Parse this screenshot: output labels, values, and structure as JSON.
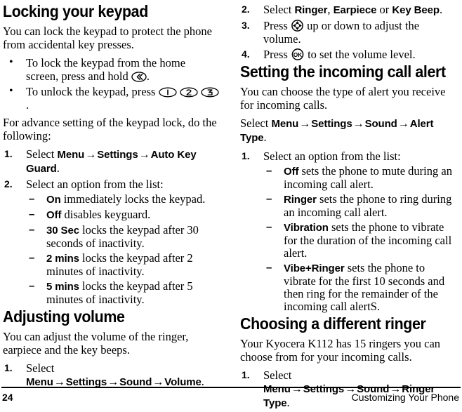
{
  "document": {
    "page_number": "24",
    "chapter_title": "Customizing Your Phone"
  },
  "left_column": {
    "heading_1": "Locking your keypad",
    "intro": "You can lock the keypad to protect the phone from accidental key presses.",
    "bullets": [
      {
        "text_before": "To lock the keypad from the home screen, press and hold",
        "icon": "back-key-icon",
        "text_after": "."
      },
      {
        "text_before": "To unlock the keypad, press",
        "icons": [
          "key-1-icon",
          "key-2-icon",
          "key-3-icon"
        ],
        "text_after": "."
      }
    ],
    "advance_intro": "For advance setting of the keypad lock, do the following:",
    "steps": [
      {
        "num": "1.",
        "lead": "Select",
        "path": [
          "Menu",
          "Settings",
          "Auto Key Guard"
        ],
        "tail": "."
      },
      {
        "num": "2.",
        "lead": "Select an option from the list:",
        "options": [
          {
            "term": "On",
            "desc": "immediately locks the keypad."
          },
          {
            "term": "Off",
            "desc": "disables keyguard."
          },
          {
            "term": "30 Sec",
            "desc": "locks the keypad after 30 seconds of inactivity."
          },
          {
            "term": "2 mins",
            "desc": "locks the keypad after 2 minutes of inactivity."
          },
          {
            "term": "5 mins",
            "desc": "locks the keypad after 5 minutes of inactivity."
          }
        ]
      }
    ],
    "heading_2": "Adjusting volume",
    "volume_intro": "You can adjust the volume of the ringer, earpiece and the key beeps.",
    "volume_step": {
      "num": "1.",
      "lead": "Select",
      "path": [
        "Menu",
        "Settings",
        "Sound",
        "Volume"
      ],
      "tail": "."
    }
  },
  "right_column": {
    "volume_steps": [
      {
        "num": "2.",
        "lead": "Select",
        "terms": [
          "Ringer",
          "Earpiece",
          "Key Beep"
        ],
        "separator_1": ",",
        "separator_2": "or",
        "tail": "."
      },
      {
        "num": "3.",
        "lead": "Press",
        "icon": "nav-key-icon",
        "tail": "up or down to adjust the volume."
      },
      {
        "num": "4.",
        "lead": "Press",
        "icon": "ok-key-icon",
        "tail": "to set the volume level."
      }
    ],
    "heading_1": "Setting the incoming call alert",
    "alert_intro": "You can choose the type of alert you receive for incoming calls.",
    "alert_select": {
      "lead": "Select",
      "path": [
        "Menu",
        "Settings",
        "Sound",
        "Alert Type"
      ],
      "tail": "."
    },
    "alert_step": {
      "num": "1.",
      "lead": "Select an option from the list:",
      "options": [
        {
          "term": "Off",
          "desc": "sets the phone to mute during an incoming call alert."
        },
        {
          "term": "Ringer",
          "desc": "sets the phone to ring during an incoming call alert."
        },
        {
          "term": "Vibration",
          "desc": "sets the phone to vibrate for the duration of the incoming call alert."
        },
        {
          "term": "Vibe+Ringer",
          "desc": "sets the phone to vibrate for the first 10 seconds and then ring for the remainder of the incoming call alertS."
        }
      ]
    },
    "heading_2": "Choosing a different ringer",
    "ringer_intro": "Your Kyocera K112 has 15 ringers you can choose from for your incoming calls.",
    "ringer_step": {
      "num": "1.",
      "lead": "Select",
      "path": [
        "Menu",
        "Settings",
        "Sound",
        "Ringer Type"
      ],
      "tail": "."
    }
  },
  "symbols": {
    "bullet": "•",
    "dash": "–",
    "arrow": "→"
  }
}
